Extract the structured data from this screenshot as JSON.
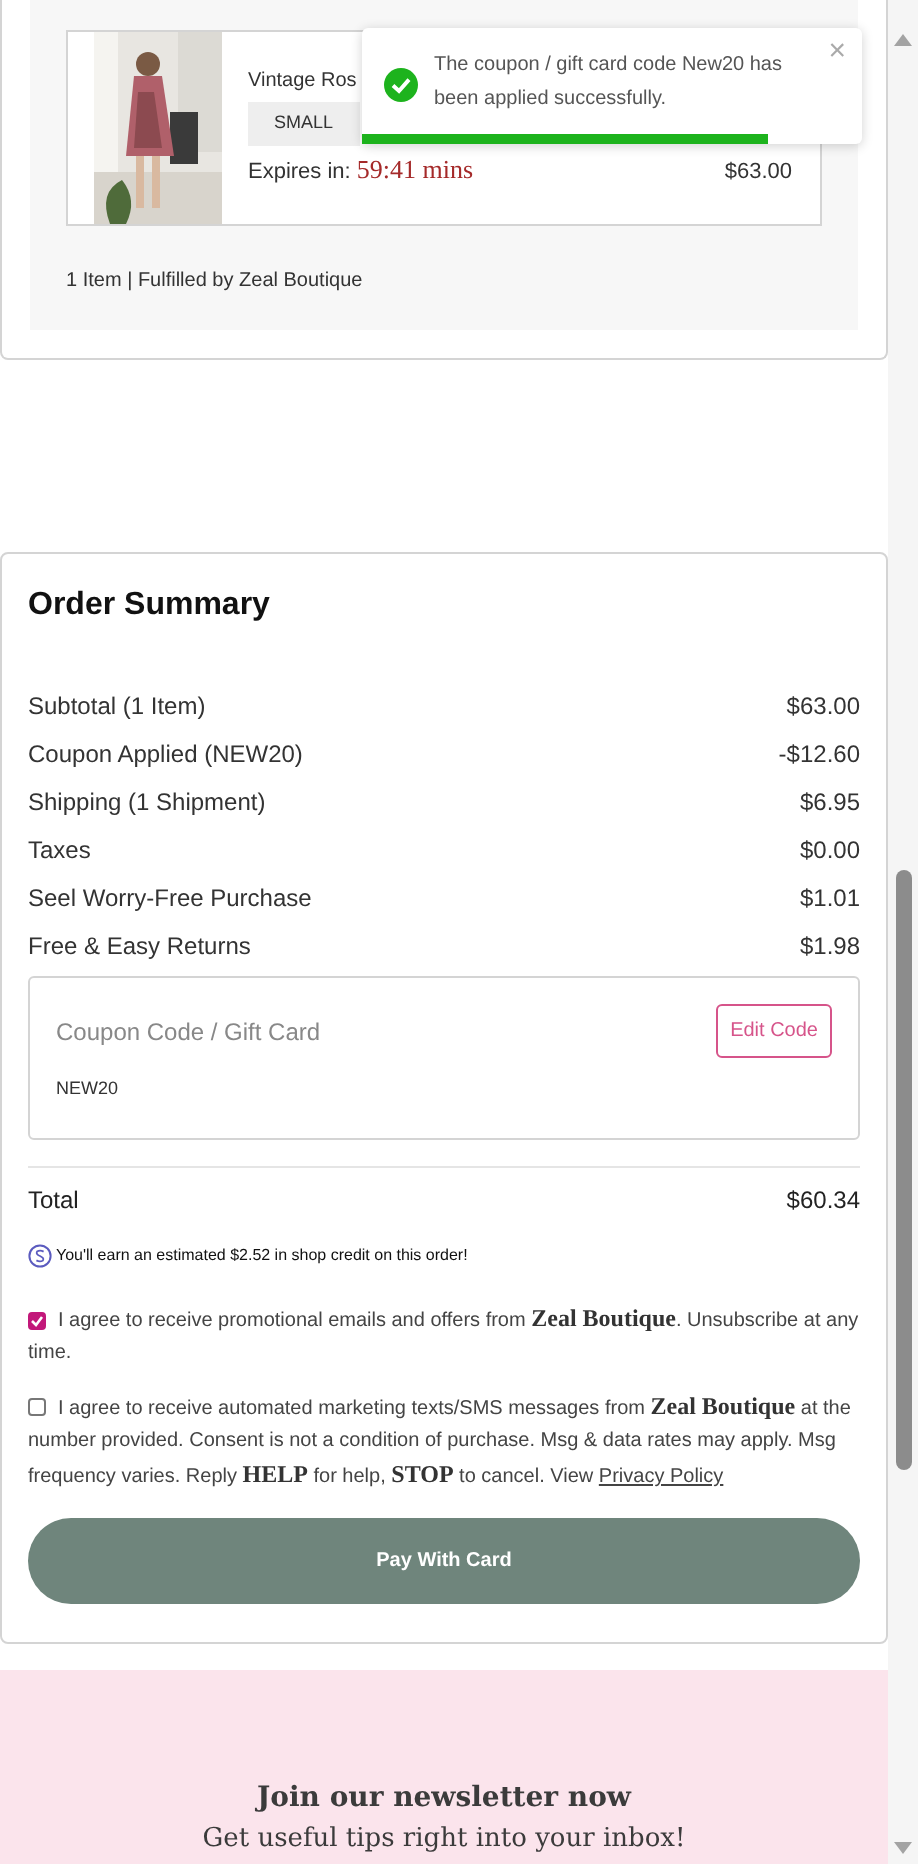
{
  "cart_item": {
    "name": "Vintage Ros",
    "size": "SMALL",
    "expires_label": "Expires in:",
    "expires_time": "59:41 mins",
    "price": "$63.00"
  },
  "fulfillment": "1 Item | Fulfilled by Zeal Boutique",
  "toast": {
    "message": "The coupon / gift card code New20 has been applied successfully.",
    "close": "×",
    "level": 0.81
  },
  "order_summary": {
    "title": "Order Summary",
    "lines": [
      {
        "label": "Subtotal (1 Item)",
        "amount": "$63.00"
      },
      {
        "label": "Coupon Applied (NEW20)",
        "amount": "-$12.60"
      },
      {
        "label": "Shipping (1 Shipment)",
        "amount": "$6.95"
      },
      {
        "label": "Taxes",
        "amount": "$0.00"
      },
      {
        "label": "Seel Worry-Free Purchase",
        "amount": "$1.01"
      },
      {
        "label": "Free & Easy Returns",
        "amount": "$1.98"
      }
    ],
    "coupon": {
      "label": "Coupon Code / Gift Card",
      "button": "Edit Code",
      "code": "NEW20"
    },
    "total": {
      "label": "Total",
      "amount": "$60.34"
    },
    "credit_note": "You'll earn an estimated $2.52 in shop credit on this order!",
    "consents": [
      {
        "text": "I agree to receive promotional emails and offers from **Zeal Boutique**. Unsubscribe at any time.",
        "checked": true
      },
      {
        "text": "I agree to receive automated marketing texts/SMS messages from **Zeal Boutique** at the number provided. Consent is not a condition of purchase. Msg & data rates may apply. Msg frequency varies. Reply **HELP** for help, **STOP** to cancel. View",
        "link": "Privacy Policy",
        "checked": false
      }
    ],
    "pay_button": "Pay With Card"
  },
  "newsletter": {
    "title": "Join our newsletter now",
    "subtitle": "Get useful tips right into your inbox!"
  }
}
